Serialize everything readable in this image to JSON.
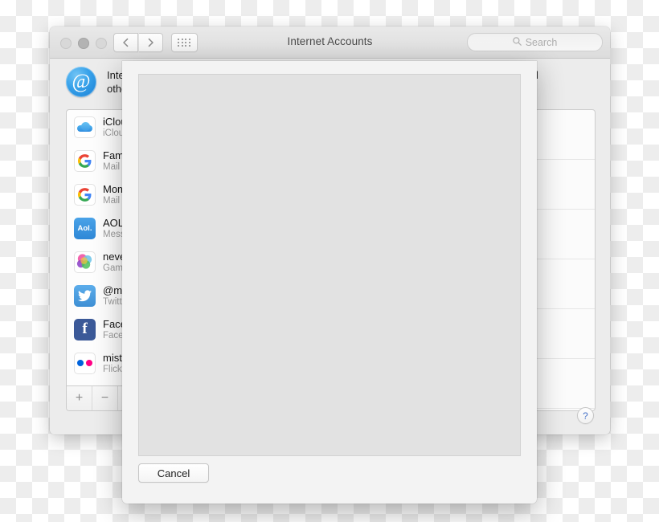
{
  "window": {
    "title": "Internet Accounts",
    "traffic_lights": [
      "close",
      "minimize",
      "zoom"
    ],
    "toolbar": {
      "back_label": "Back",
      "forward_label": "Forward",
      "show_all_label": "Show All"
    },
    "search": {
      "placeholder": "Search",
      "value": ""
    }
  },
  "header": {
    "icon": "at-sign-icon",
    "line1": "Internet Accounts sets up your accounts to use with Mail, Contacts, Calendar, Messages, and",
    "line2": "other apps."
  },
  "sidebar": {
    "accounts": [
      {
        "name": "iCloud",
        "services": "iCloud",
        "icon": "icloud-icon"
      },
      {
        "name": "Family",
        "services": "Mail",
        "icon": "google-icon"
      },
      {
        "name": "Mom",
        "services": "Mail",
        "icon": "google-icon"
      },
      {
        "name": "AOL",
        "services": "Messages",
        "icon": "aol-icon"
      },
      {
        "name": "neverland",
        "services": "Game Center",
        "icon": "game-center-icon"
      },
      {
        "name": "@misterwhite",
        "services": "Twitter",
        "icon": "twitter-icon"
      },
      {
        "name": "Facebook",
        "services": "Facebook",
        "icon": "facebook-icon"
      },
      {
        "name": "misterwhite",
        "services": "Flickr",
        "icon": "flickr-icon"
      }
    ],
    "add_label": "+",
    "remove_label": "−"
  },
  "right_panel": {
    "help_label": "?"
  },
  "sheet": {
    "cancel_label": "Cancel"
  },
  "colors": {
    "accent": "#3d9ce6",
    "help_blue": "#4a74c9",
    "window_bg": "#ececec",
    "sheet_bg": "#f3f3f3",
    "sheet_panel": "#e2e2e2"
  }
}
